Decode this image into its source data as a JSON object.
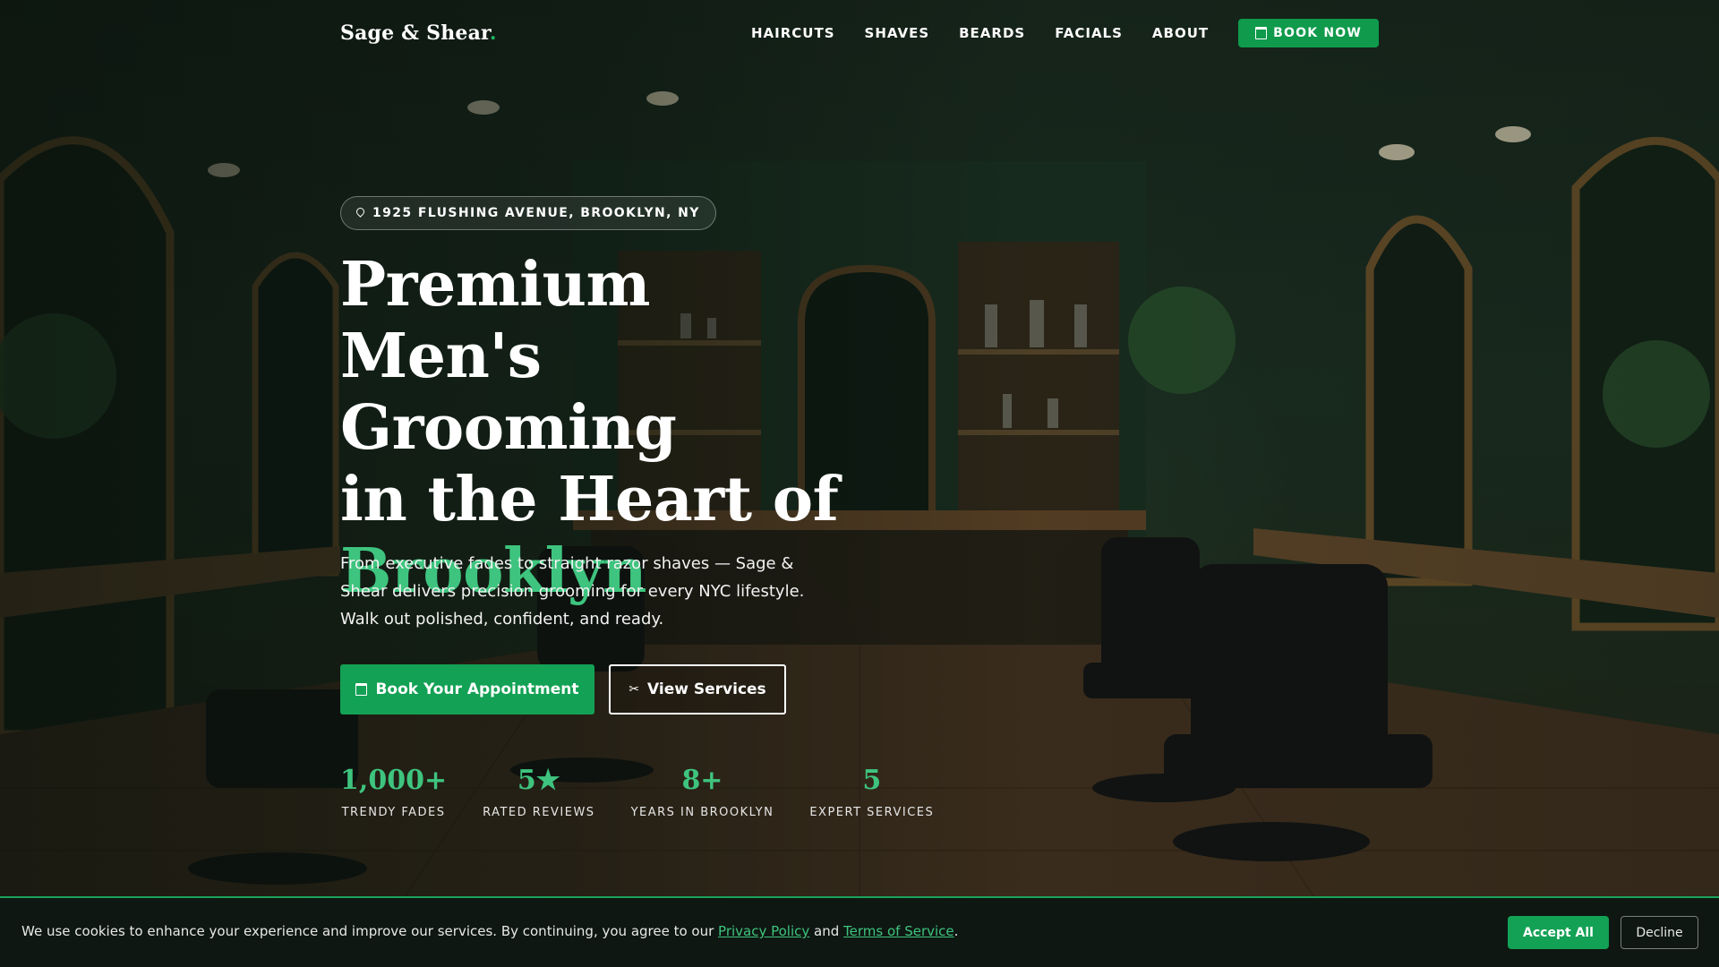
{
  "colors": {
    "accent": "#13a155",
    "accent_text": "#3ec47e",
    "background_dark": "#0e1712"
  },
  "nav": {
    "logo_text": "Sage & Shear",
    "logo_dot": ".",
    "links": [
      "HAIRCUTS",
      "SHAVES",
      "BEARDS",
      "FACIALS",
      "ABOUT"
    ],
    "book_icon": "calendar-icon",
    "book_label": "BOOK NOW"
  },
  "hero": {
    "location_icon": "map-pin-icon",
    "location": "1925 FLUSHING AVENUE, BROOKLYN, NY",
    "headline_lines": [
      "Premium Men's",
      "Grooming",
      "in the Heart of"
    ],
    "headline_accent": "Brooklyn",
    "intro": "From executive fades to straight razor shaves — Sage & Shear delivers precision grooming for every NYC lifestyle. Walk out polished, confident, and ready.",
    "cta_primary": "Book Your Appointment",
    "cta_primary_icon": "calendar-icon",
    "cta_secondary": "View Services",
    "cta_secondary_icon": "scissors-icon"
  },
  "stats": [
    {
      "value": "1,000+",
      "label": "TRENDY FADES"
    },
    {
      "value": "5★",
      "label": "RATED REVIEWS"
    },
    {
      "value": "8+",
      "label": "YEARS IN BROOKLYN"
    },
    {
      "value": "5",
      "label": "EXPERT SERVICES"
    }
  ],
  "cookie": {
    "text_before": "We use cookies to enhance your experience and improve our services. By continuing, you agree to our ",
    "privacy_link": "Privacy Policy",
    "text_middle": " and ",
    "terms_link": "Terms of Service",
    "text_after": ".",
    "accept_label": "Accept All",
    "decline_label": "Decline"
  }
}
